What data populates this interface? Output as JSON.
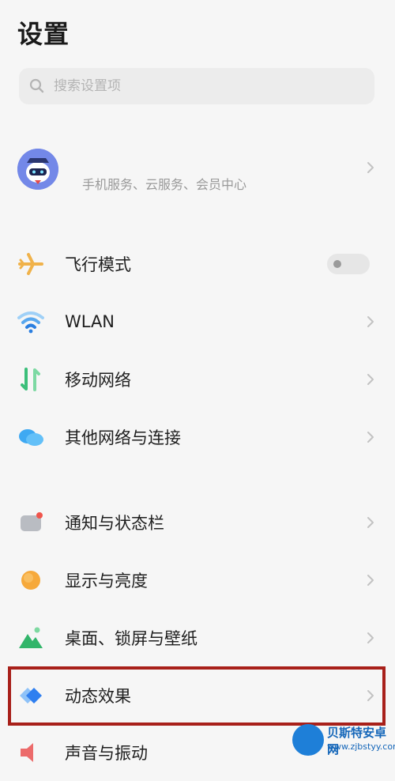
{
  "header": {
    "title": "设置"
  },
  "search": {
    "placeholder": "搜索设置项",
    "value": ""
  },
  "account": {
    "subtitle": "手机服务、云服务、会员中心"
  },
  "settings": [
    {
      "label": "飞行模式",
      "icon": "airplane-icon",
      "control": "toggle",
      "toggle_on": false
    },
    {
      "label": "WLAN",
      "icon": "wifi-icon",
      "control": "chevron"
    },
    {
      "label": "移动网络",
      "icon": "mobile-network-icon",
      "control": "chevron"
    },
    {
      "label": "其他网络与连接",
      "icon": "cloud-icon",
      "control": "chevron"
    },
    {
      "label": "通知与状态栏",
      "icon": "notification-icon",
      "control": "chevron"
    },
    {
      "label": "显示与亮度",
      "icon": "brightness-icon",
      "control": "chevron"
    },
    {
      "label": "桌面、锁屏与壁纸",
      "icon": "wallpaper-icon",
      "control": "chevron"
    },
    {
      "label": "动态效果",
      "icon": "animation-icon",
      "control": "chevron",
      "highlighted": true
    },
    {
      "label": "声音与振动",
      "icon": "sound-icon",
      "control": "chevron"
    }
  ],
  "watermark": {
    "title": "贝斯特安卓网",
    "url": "www.zjbstyy.com"
  },
  "colors": {
    "highlight_border": "#a8201a",
    "background": "#f6f6f6"
  }
}
